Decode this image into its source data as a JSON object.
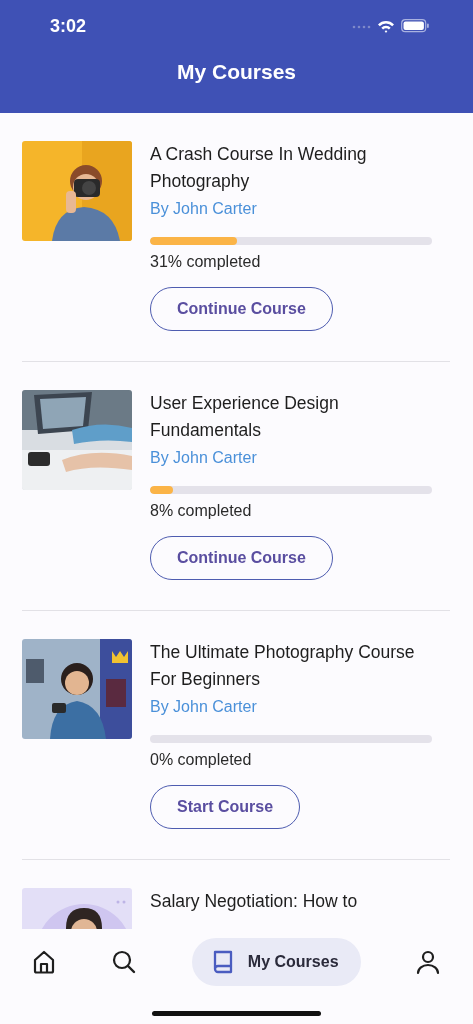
{
  "status_bar": {
    "time": "3:02"
  },
  "header": {
    "title": "My Courses"
  },
  "courses": [
    {
      "title": "A Crash Course In Wedding Photography",
      "author": "By John Carter",
      "level": 0.31,
      "progress_text": "31% completed",
      "button": "Continue Course"
    },
    {
      "title": "User Experience Design Fundamentals",
      "author": "By John Carter",
      "level": 0.08,
      "progress_text": "8% completed",
      "button": "Continue Course"
    },
    {
      "title": "The Ultimate Photography Course For Beginners",
      "author": "By John Carter",
      "level": 0,
      "progress_text": "0% completed",
      "button": "Start Course"
    },
    {
      "title": "Salary Negotiation: How to"
    }
  ],
  "nav": [
    {
      "kind": "home",
      "selected": false
    },
    {
      "kind": "search",
      "selected": false
    },
    {
      "kind": "courses",
      "label": "My Courses",
      "selected": true
    },
    {
      "kind": "profile",
      "selected": false
    }
  ]
}
